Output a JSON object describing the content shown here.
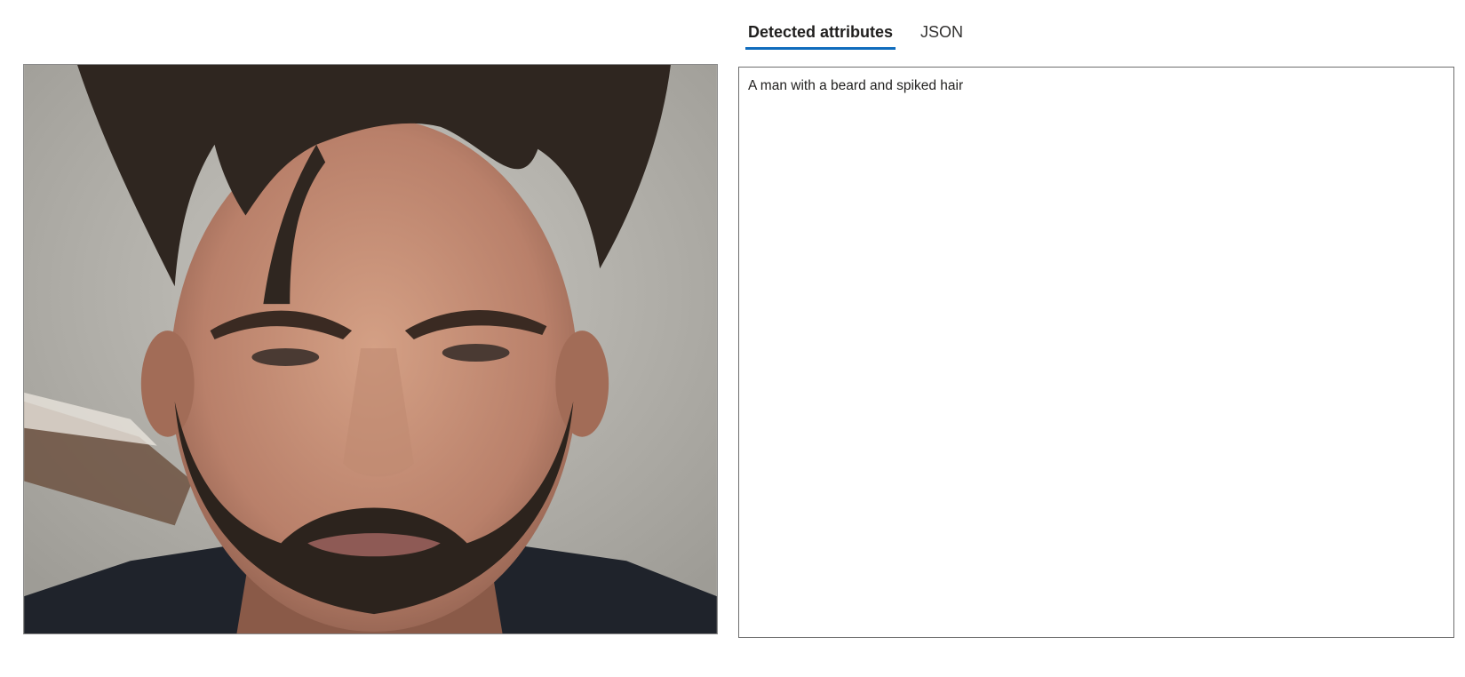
{
  "tabs": [
    {
      "label": "Detected attributes",
      "active": true
    },
    {
      "label": "JSON",
      "active": false
    }
  ],
  "result": {
    "caption": "A man with a beard and spiked hair"
  },
  "colors": {
    "tab_accent": "#0f6cbd",
    "panel_border": "#6e6e6e"
  }
}
